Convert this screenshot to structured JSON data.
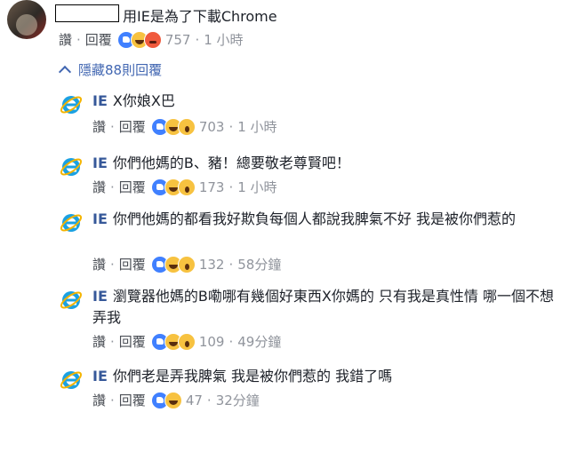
{
  "top_comment": {
    "text": "用IE是為了下載Chrome",
    "actions": {
      "like": "讚",
      "reply": "回覆"
    },
    "reactions": [
      "like",
      "haha",
      "angry"
    ],
    "count": "757",
    "time": "1 小時"
  },
  "hide_replies": "隱藏88則回覆",
  "replies": [
    {
      "name": "IE",
      "text": "X你娘X巴",
      "like": "讚",
      "reply": "回覆",
      "reactions": [
        "like",
        "haha",
        "wow"
      ],
      "count": "703",
      "time": "1 小時"
    },
    {
      "name": "IE",
      "text": "你們他媽的B、豬！總要敬老尊賢吧！",
      "like": "讚",
      "reply": "回覆",
      "reactions": [
        "like",
        "haha",
        "wow"
      ],
      "count": "173",
      "time": "1 小時"
    },
    {
      "name": "IE",
      "text": "你們他媽的都看我好欺負每個人都說我脾氣不好 我是被你們惹的",
      "like": "讚",
      "reply": "回覆",
      "reactions": [
        "like",
        "haha",
        "wow"
      ],
      "count": "132",
      "time": "58分鐘"
    },
    {
      "name": "IE",
      "text": "瀏覽器他媽的B嘞哪有幾個好東西X你媽的 只有我是真性情 哪一個不想弄我",
      "like": "讚",
      "reply": "回覆",
      "reactions": [
        "like",
        "haha",
        "wow"
      ],
      "count": "109",
      "time": "49分鐘"
    },
    {
      "name": "IE",
      "text": "你們老是弄我脾氣 我是被你們惹的 我錯了嗎",
      "like": "讚",
      "reply": "回覆",
      "reactions": [
        "like",
        "haha"
      ],
      "count": "47",
      "time": "32分鐘"
    }
  ]
}
